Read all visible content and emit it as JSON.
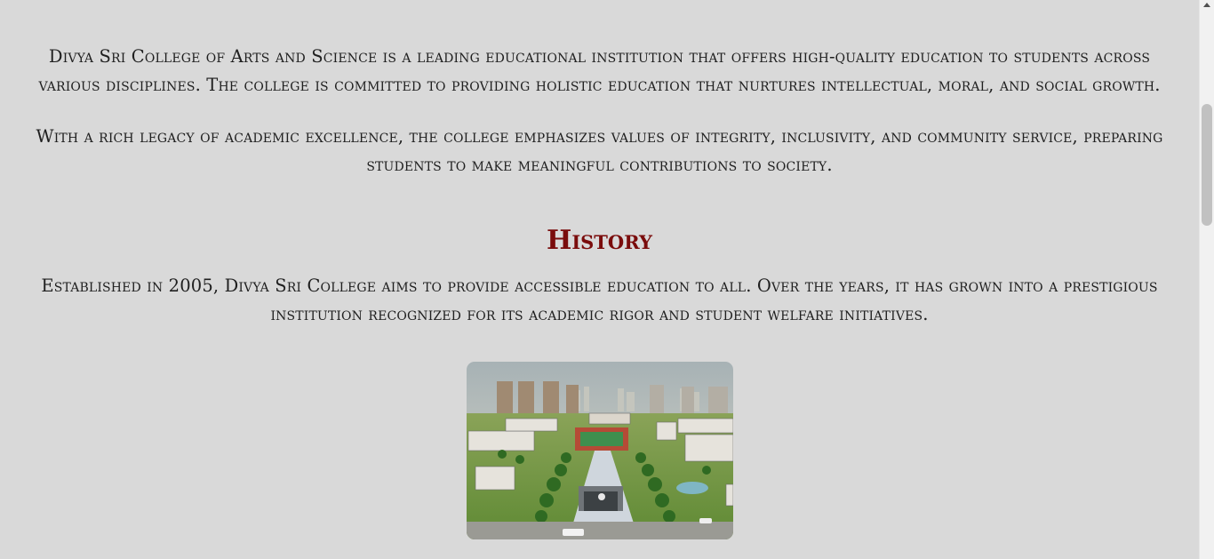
{
  "about": {
    "intro": "Divya Sri College of Arts and Science is a leading educational institution that offers high-quality education to students across various disciplines. The college is committed to providing holistic education that nurtures intellectual, moral, and social growth.",
    "legacy": "With a rich legacy of academic excellence, the college emphasizes values of integrity, inclusivity, and community service, preparing students to make meaningful contributions to society."
  },
  "history": {
    "title": "History",
    "text": "Established in 2005, Divya Sri College aims to provide accessible education to all. Over the years, it has grown into a prestigious institution recognized for its academic rigor and student welfare initiatives."
  },
  "colors": {
    "background": "#d9d9d9",
    "heading": "#7a0c0c",
    "text": "#1f1f1f"
  },
  "scroll": {
    "thumb_position_fraction": 0.19
  }
}
